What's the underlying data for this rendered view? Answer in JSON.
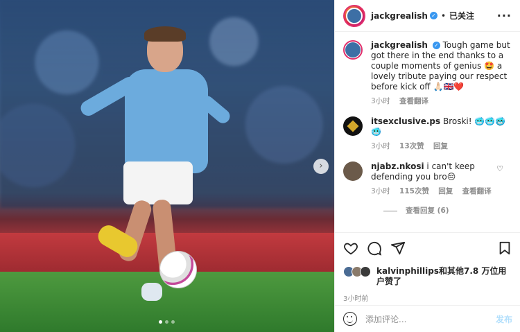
{
  "post": {
    "username": "jackgrealish",
    "verified_mark": "✓",
    "separator": "•",
    "follow_status": "已关注",
    "more_icon": "more-horizontal-icon"
  },
  "caption": {
    "username": "jackgrealish",
    "text": "Tough game but got there in the end thanks to a couple moments of genius 🤩 a lovely tribute paying our respect before kick off 🙏🏻🇬🇧❤️",
    "time": "3小时",
    "translate": "查看翻译"
  },
  "comments": [
    {
      "username": "itsexclusive.ps",
      "text": "Broski! 🥶🥶🥶🥶",
      "time": "3小时",
      "likes": "13次赞",
      "reply": "回复"
    },
    {
      "username": "njabz.nkosi",
      "text": "i can't keep defending you bro😔",
      "time": "3小时",
      "likes": "115次赞",
      "reply": "回复",
      "translate": "查看翻译"
    }
  ],
  "view_replies": "查看回复 (6)",
  "likes": {
    "text": "kalvinphillips和其他7.8 万位用户赞了"
  },
  "post_time": "3小时前",
  "composer": {
    "placeholder": "添加评论...",
    "publish": "发布"
  },
  "colors": {
    "verified": "#3897f0",
    "publish": "#b2dffc",
    "ring": "#e1306c"
  }
}
